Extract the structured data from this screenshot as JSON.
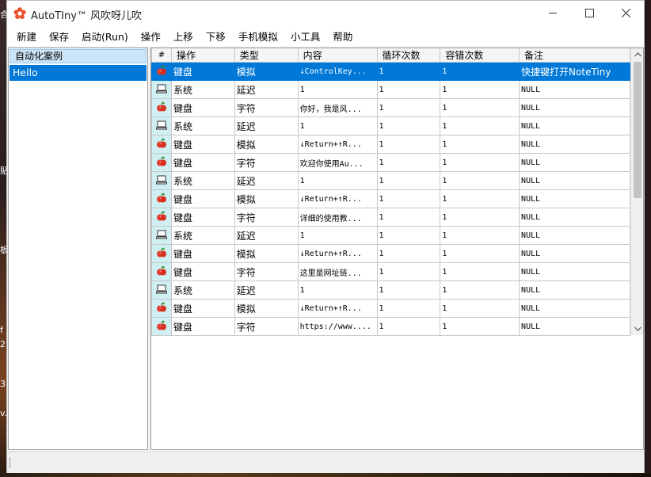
{
  "window": {
    "title": "AutoTIny™ 风吹呀儿吹",
    "icon": "flower-icon",
    "controls": [
      "minimize",
      "maximize",
      "close"
    ]
  },
  "desktop": {
    "fragments": [
      "合",
      "贴",
      "板",
      "f",
      "2",
      "3",
      "v."
    ]
  },
  "menu": [
    "新建",
    "保存",
    "启动(Run)",
    "操作",
    "上移",
    "下移",
    "手机模拟",
    "小工具",
    "帮助"
  ],
  "sidebar": {
    "header": "自动化案例",
    "items": [
      {
        "label": "Hello",
        "selected": true
      }
    ]
  },
  "grid": {
    "columns": [
      "#",
      "操作",
      "类型",
      "内容",
      "循环次数",
      "容错次数",
      "备注"
    ],
    "rows": [
      {
        "icon": "apple-icon",
        "op": "键盘",
        "type": "模拟",
        "content": "↓ControlKey...",
        "loop": "1",
        "retry": "1",
        "note": "快捷键打开NoteTiny",
        "selected": true
      },
      {
        "icon": "monitor-icon",
        "op": "系统",
        "type": "延迟",
        "content": "1",
        "loop": "1",
        "retry": "1",
        "note": "NULL"
      },
      {
        "icon": "apple-icon",
        "op": "键盘",
        "type": "字符",
        "content": "你好，我是风...",
        "loop": "1",
        "retry": "1",
        "note": "NULL"
      },
      {
        "icon": "monitor-icon",
        "op": "系统",
        "type": "延迟",
        "content": "1",
        "loop": "1",
        "retry": "1",
        "note": "NULL"
      },
      {
        "icon": "apple-icon",
        "op": "键盘",
        "type": "模拟",
        "content": "↓Return+↑R...",
        "loop": "1",
        "retry": "1",
        "note": "NULL"
      },
      {
        "icon": "apple-icon",
        "op": "键盘",
        "type": "字符",
        "content": "欢迎你使用Au...",
        "loop": "1",
        "retry": "1",
        "note": "NULL"
      },
      {
        "icon": "monitor-icon",
        "op": "系统",
        "type": "延迟",
        "content": "1",
        "loop": "1",
        "retry": "1",
        "note": "NULL"
      },
      {
        "icon": "apple-icon",
        "op": "键盘",
        "type": "模拟",
        "content": "↓Return+↑R...",
        "loop": "1",
        "retry": "1",
        "note": "NULL"
      },
      {
        "icon": "apple-icon",
        "op": "键盘",
        "type": "字符",
        "content": "详细的使用教...",
        "loop": "1",
        "retry": "1",
        "note": "NULL"
      },
      {
        "icon": "monitor-icon",
        "op": "系统",
        "type": "延迟",
        "content": "1",
        "loop": "1",
        "retry": "1",
        "note": "NULL"
      },
      {
        "icon": "apple-icon",
        "op": "键盘",
        "type": "模拟",
        "content": "↓Return+↑R...",
        "loop": "1",
        "retry": "1",
        "note": "NULL"
      },
      {
        "icon": "apple-icon",
        "op": "键盘",
        "type": "字符",
        "content": "这里是网址链...",
        "loop": "1",
        "retry": "1",
        "note": "NULL"
      },
      {
        "icon": "monitor-icon",
        "op": "系统",
        "type": "延迟",
        "content": "1",
        "loop": "1",
        "retry": "1",
        "note": "NULL"
      },
      {
        "icon": "apple-icon",
        "op": "键盘",
        "type": "模拟",
        "content": "↓Return+↑R...",
        "loop": "1",
        "retry": "1",
        "note": "NULL"
      },
      {
        "icon": "apple-icon",
        "op": "键盘",
        "type": "字符",
        "content": "https://www....",
        "loop": "1",
        "retry": "1",
        "note": "NULL"
      }
    ]
  },
  "colors": {
    "accent": "#0078d7",
    "icon_col": "#cfeff3",
    "apple": "#e53b2c"
  }
}
